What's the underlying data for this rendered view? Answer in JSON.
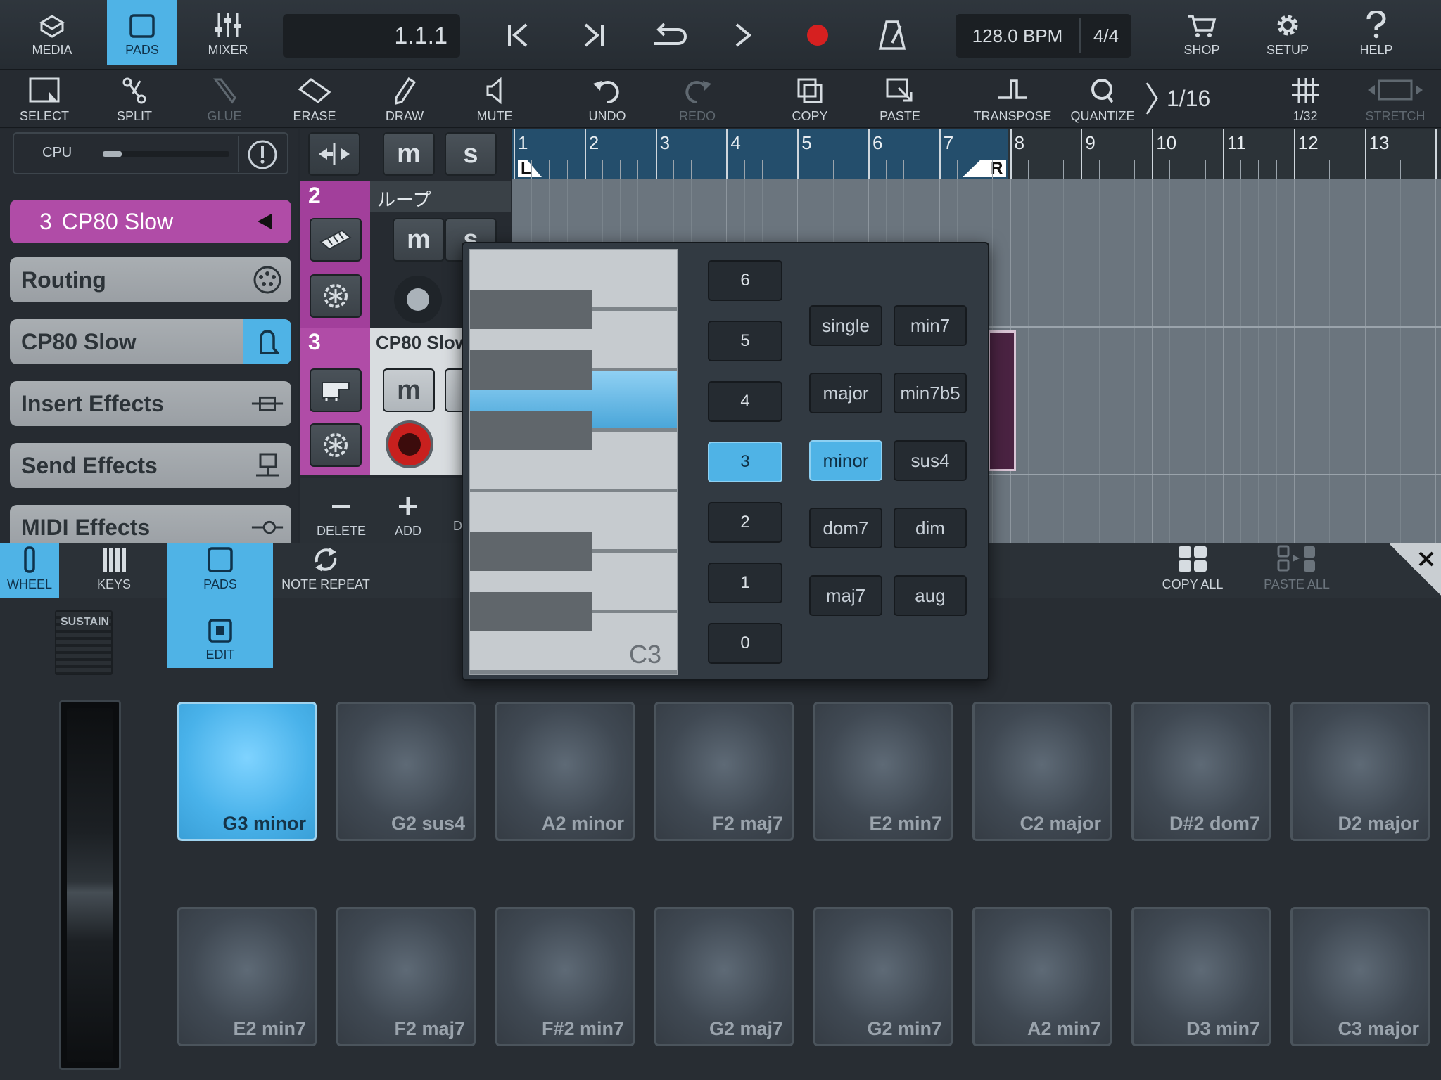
{
  "toolbar": {
    "media": "MEDIA",
    "pads": "PADS",
    "mixer": "MIXER",
    "position": "1.1.1",
    "tempo": "128.0 BPM",
    "signature": "4/4",
    "shop": "SHOP",
    "setup": "SETUP",
    "help": "HELP"
  },
  "tools": {
    "select": "SELECT",
    "split": "SPLIT",
    "glue": "GLUE",
    "erase": "ERASE",
    "draw": "DRAW",
    "mute": "MUTE",
    "undo": "UNDO",
    "redo": "REDO",
    "copy": "COPY",
    "paste": "PASTE",
    "transpose": "TRANSPOSE",
    "quantize": "QUANTIZE",
    "quantize_value": "1/16",
    "grid": "1/32",
    "stretch": "STRETCH"
  },
  "inspector": {
    "cpu_label": "CPU",
    "cpu_level": 0.15,
    "track_number": "3",
    "track_name": "CP80 Slow",
    "items": [
      "Routing",
      "CP80 Slow",
      "Insert Effects",
      "Send Effects",
      "MIDI Effects"
    ]
  },
  "tracks": {
    "t2_number": "2",
    "t2_name": "ループ",
    "t3_number": "3",
    "t3_name": "CP80 Slow",
    "mute_glyph": "m",
    "solo_glyph": "s",
    "delete": "DELETE",
    "add": "ADD",
    "cut_label": "D"
  },
  "arrange": {
    "bars": [
      "1",
      "2",
      "3",
      "4",
      "5",
      "6",
      "7",
      "8",
      "9",
      "10",
      "11",
      "12",
      "13",
      "1"
    ],
    "locator_left": "L",
    "locator_right": "R"
  },
  "bottom_tabs": {
    "wheel": "WHEEL",
    "keys": "KEYS",
    "pads": "PADS",
    "note_repeat": "NOTE REPEAT",
    "edit": "EDIT",
    "copy_all": "COPY ALL",
    "paste_all": "PASTE ALL",
    "sustain": "SUSTAIN"
  },
  "popup": {
    "key_label": "C3",
    "octaves": [
      "6",
      "5",
      "4",
      "3",
      "2",
      "1",
      "0"
    ],
    "selected_octave": "3",
    "chords": [
      "single",
      "min7",
      "major",
      "min7b5",
      "minor",
      "sus4",
      "dom7",
      "dim",
      "maj7",
      "aug"
    ],
    "selected_chord": "minor"
  },
  "pads": {
    "row1": [
      "G3 minor",
      "G2 sus4",
      "A2 minor",
      "F2 maj7",
      "E2 min7",
      "C2 major",
      "D#2 dom7",
      "D2 major"
    ],
    "row2": [
      "E2 min7",
      "F2 maj7",
      "F#2 min7",
      "G2 maj7",
      "G2 min7",
      "A2 min7",
      "D3 min7",
      "C3 major"
    ],
    "active": "G3 minor"
  },
  "colors": {
    "accent": "#4fb3e6",
    "track_purple": "#b04ca7",
    "record_red": "#d62020"
  }
}
